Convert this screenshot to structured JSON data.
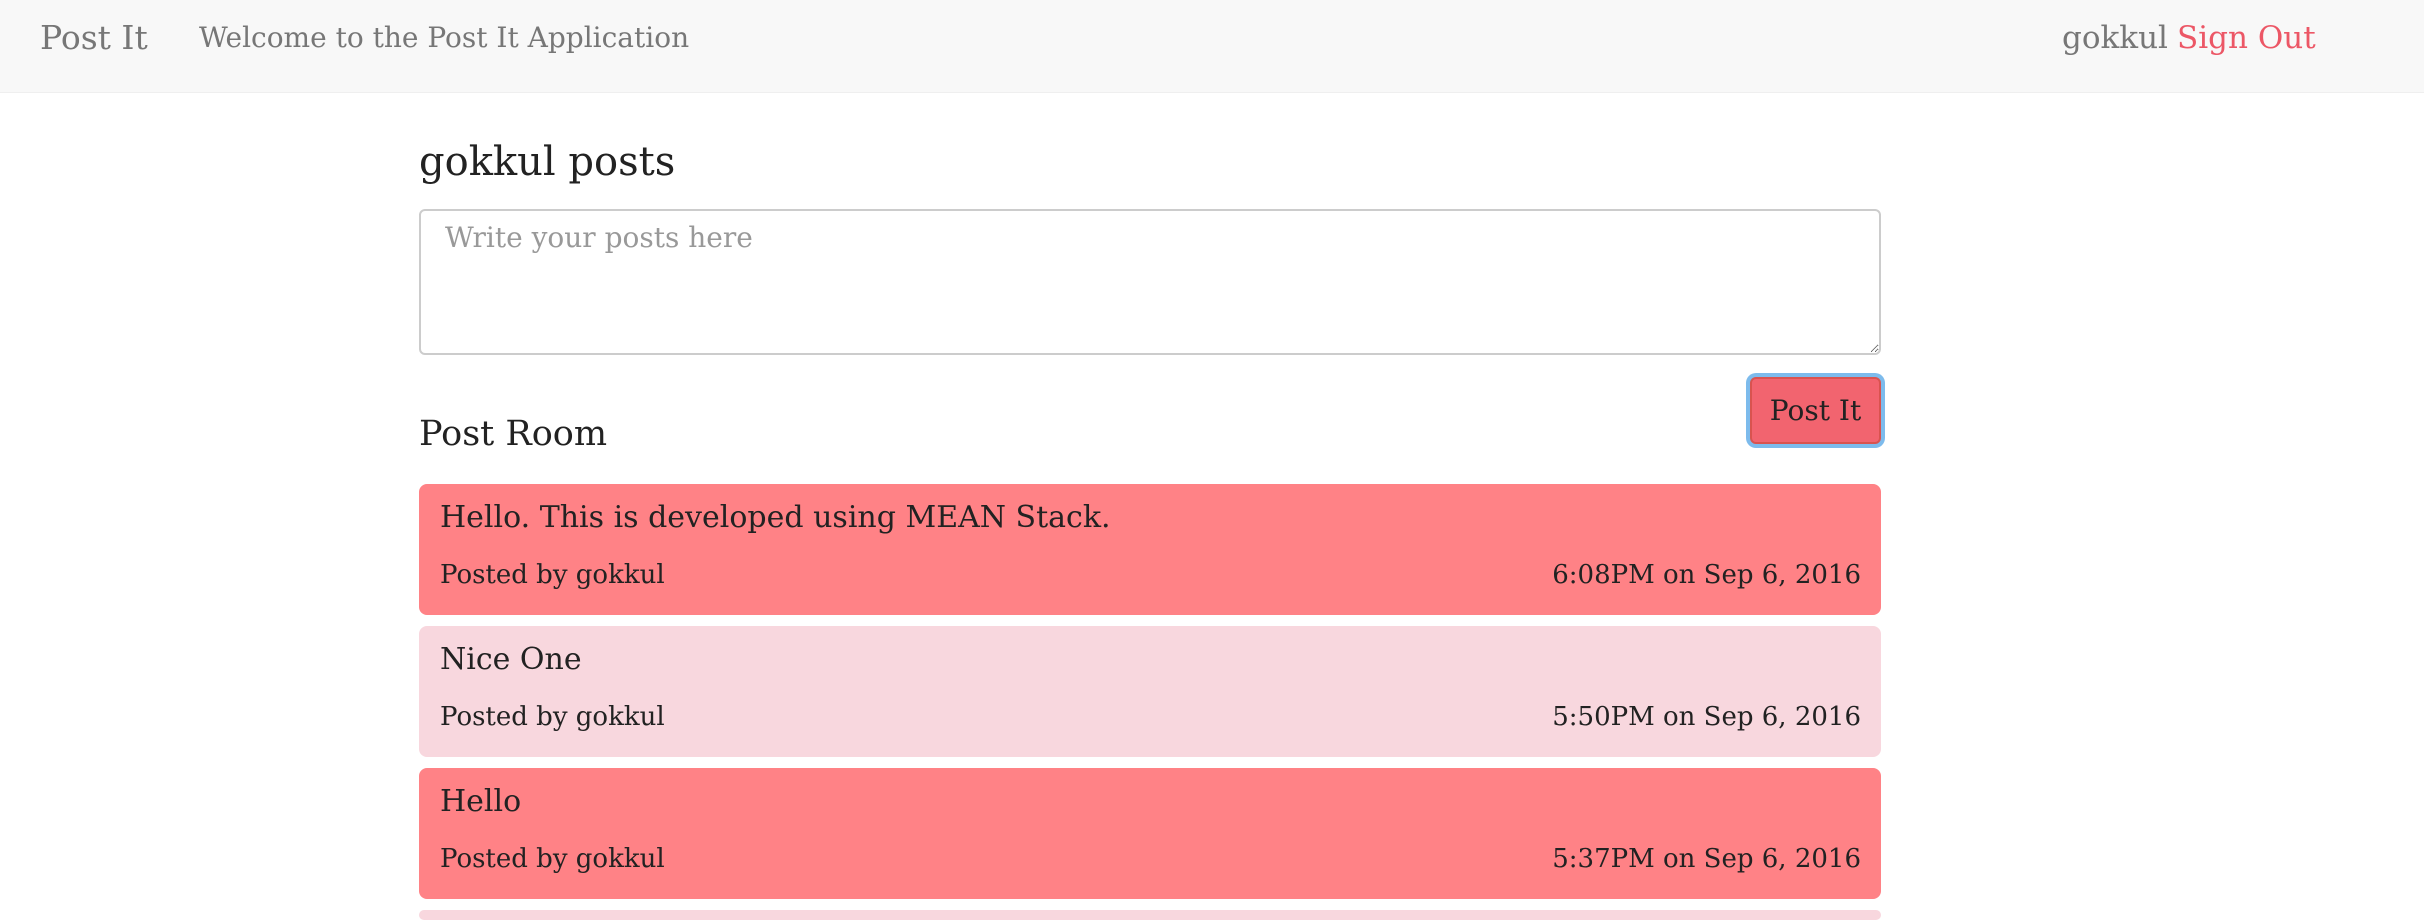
{
  "navbar": {
    "brand": "Post It",
    "welcome": "Welcome to the Post It Application",
    "username": "gokkul",
    "sign_out": "Sign Out"
  },
  "page": {
    "title": "gokkul posts",
    "textarea_placeholder": "Write your posts here",
    "textarea_value": "",
    "post_button": "Post It",
    "post_room_title": "Post Room"
  },
  "posts": [
    {
      "text": "Hello. This is developed using MEAN Stack.",
      "author": "Posted by gokkul",
      "time": "6:08PM on Sep 6, 2016",
      "style": "dark"
    },
    {
      "text": "Nice One",
      "author": "Posted by gokkul",
      "time": "5:50PM on Sep 6, 2016",
      "style": "light"
    },
    {
      "text": "Hello",
      "author": "Posted by gokkul",
      "time": "5:37PM on Sep 6, 2016",
      "style": "dark"
    }
  ],
  "colors": {
    "accent": "#ec5766",
    "post_dark": "#ff8286",
    "post_light": "#f8d7de",
    "navbar_bg": "#f8f8f8"
  }
}
